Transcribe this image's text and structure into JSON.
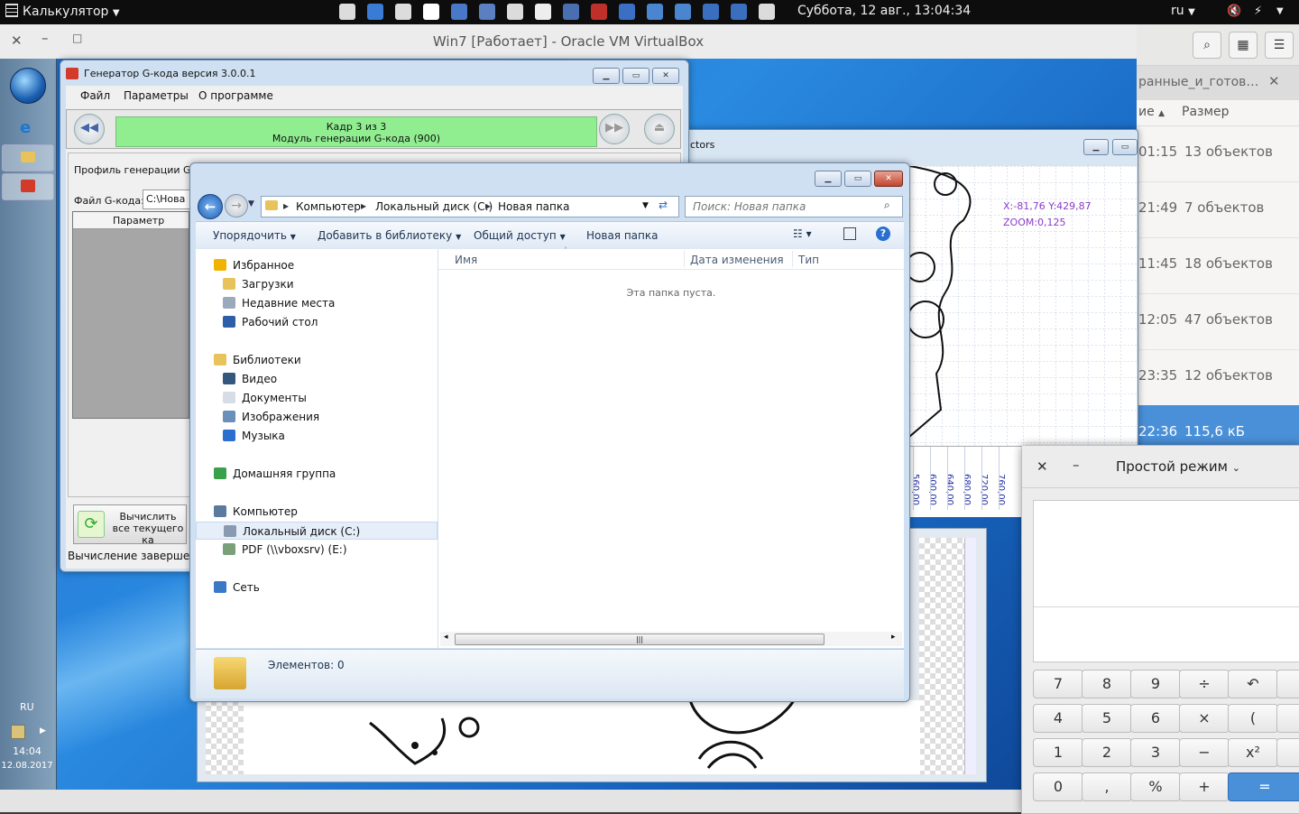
{
  "topbar": {
    "app_name": "Калькулятор",
    "clock": "Суббота, 12 авг., 13:04:34",
    "lang": "ru",
    "tray_colors": [
      "#dcdcdc",
      "#3a7bd5",
      "#dcdcdc",
      "#ffffff",
      "#4a78c8",
      "#5b7fc0",
      "#dcdcdc",
      "#eeeeee",
      "#4a6fb0",
      "#c0302a",
      "#3b6fc4",
      "#4a86d0",
      "#4a86d0",
      "#3a6fc0",
      "#3a6fc0",
      "#dcdcdc"
    ]
  },
  "vbox": {
    "title": "Win7 [Работает] - Oracle VM VirtualBox"
  },
  "nautilus": {
    "tab_label": "ранные_и_готов…",
    "col_name": "ие",
    "col_size": "Размер",
    "rows": [
      {
        "time": "01:15",
        "size": "13 объектов"
      },
      {
        "time": "21:49",
        "size": "7 объектов"
      },
      {
        "time": "11:45",
        "size": "18 объектов"
      },
      {
        "time": "12:05",
        "size": "47 объектов"
      },
      {
        "time": "23:35",
        "size": "12 объектов"
      },
      {
        "time": "22:36",
        "size": "115,6 кБ"
      }
    ]
  },
  "win7_taskbar": {
    "lang": "RU",
    "time": "14:04",
    "date": "12.08.2017"
  },
  "gcode": {
    "title": "Генератор G-кода версия 3.0.0.1",
    "menu": [
      "Файл",
      "Параметры",
      "О программе"
    ],
    "frame_line1": "Кадр 3 из 3",
    "frame_line2": "Модуль генерации G-кода (900)",
    "profile_label": "Профиль генерации G-ко",
    "file_label": "Файл G-кода:",
    "file_value": "C:\\Нова",
    "param_header": "Параметр",
    "compute_btn": "Вычислить все текущего ка",
    "status": "Вычисление завершено"
  },
  "drawing": {
    "title_tail": "ctors",
    "coords": "X:-81,76 Y:429,87",
    "zoom": "ZOOM:0,125",
    "ruler": [
      "560,00",
      "600,00",
      "640,00",
      "680,00",
      "720,00",
      "760,00"
    ]
  },
  "explorer": {
    "breadcrumb": [
      "Компьютер",
      "Локальный диск (C:)",
      "Новая папка"
    ],
    "search_placeholder": "Поиск: Новая папка",
    "toolbar": [
      "Упорядочить",
      "Добавить в библиотеку",
      "Общий доступ",
      "Новая папка"
    ],
    "columns": [
      "Имя",
      "Дата изменения",
      "Тип"
    ],
    "empty_text": "Эта папка пуста.",
    "status": "Элементов: 0",
    "nav": {
      "favorites": "Избранное",
      "fav_items": [
        "Загрузки",
        "Недавние места",
        "Рабочий стол"
      ],
      "libraries": "Библиотеки",
      "lib_items": [
        "Видео",
        "Документы",
        "Изображения",
        "Музыка"
      ],
      "homegroup": "Домашняя группа",
      "computer": "Компьютер",
      "comp_items": [
        "Локальный диск (C:)",
        "PDF (\\\\vboxsrv) (E:)"
      ],
      "network": "Сеть"
    }
  },
  "calc": {
    "mode": "Простой режим",
    "keys": [
      [
        "7",
        "8",
        "9",
        "÷",
        "↶"
      ],
      [
        "4",
        "5",
        "6",
        "×",
        "("
      ],
      [
        "1",
        "2",
        "3",
        "−",
        "x²"
      ],
      [
        "0",
        ",",
        "%",
        "+",
        "="
      ]
    ]
  }
}
